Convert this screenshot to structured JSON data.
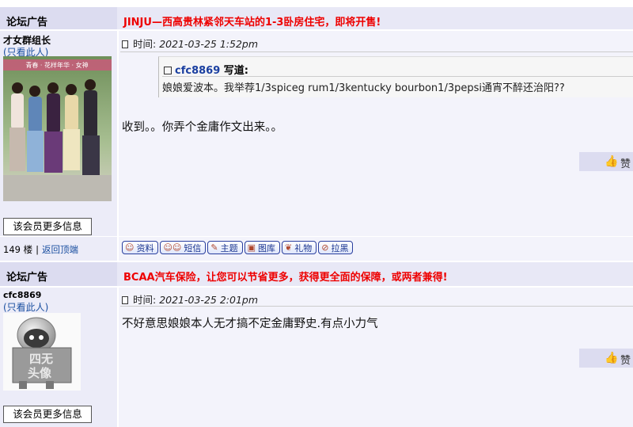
{
  "ad1": {
    "label": "论坛广告",
    "text": "JINJU—西高贵林紧邻天车站的1-3卧房住宅，即将开售!"
  },
  "post1": {
    "username": "才女群组长",
    "only_this": "(只看此人)",
    "time_label": "时间:",
    "time": "2021-03-25 1:52pm",
    "quote_user": "cfc8869",
    "quote_suffix": "写道:",
    "quote_text": "娘娘爱波本。我举荐1/3spiceg rum1/3kentucky bourbon1/3pepsi通宵不醉还治阳??",
    "body": "收到。。你弄个金庸作文出来。。",
    "like_label": "赞",
    "more_info": "该会员更多信息",
    "avatar_banner": "青春 · 花样年华 · 女神"
  },
  "footer1": {
    "floor": "149 楼",
    "back_top": "返回顶端",
    "tools": [
      {
        "icon": "profile-icon",
        "label": "资料"
      },
      {
        "icon": "message-icon",
        "label": "短信"
      },
      {
        "icon": "topic-icon",
        "label": "主题"
      },
      {
        "icon": "gallery-icon",
        "label": "图库"
      },
      {
        "icon": "gift-icon",
        "label": "礼物"
      },
      {
        "icon": "block-icon",
        "label": "拉黑"
      }
    ]
  },
  "ad2": {
    "label": "论坛广告",
    "text": "BCAA汽车保险，让您可以节省更多，获得更全面的保障，或两者兼得!"
  },
  "post2": {
    "username": "cfc8869",
    "only_this": "(只看此人)",
    "time_label": "时间:",
    "time": "2021-03-25 2:01pm",
    "body": "不好意思娘娘本人无才搞不定金庸野史.有点小力气",
    "like_label": "赞",
    "more_info": "该会员更多信息",
    "avatar_text_1": "四无",
    "avatar_text_2": "头像"
  },
  "colors": {
    "ad_text": "#ee0000",
    "link": "#1a4fa0",
    "panel": "#ececf8"
  }
}
